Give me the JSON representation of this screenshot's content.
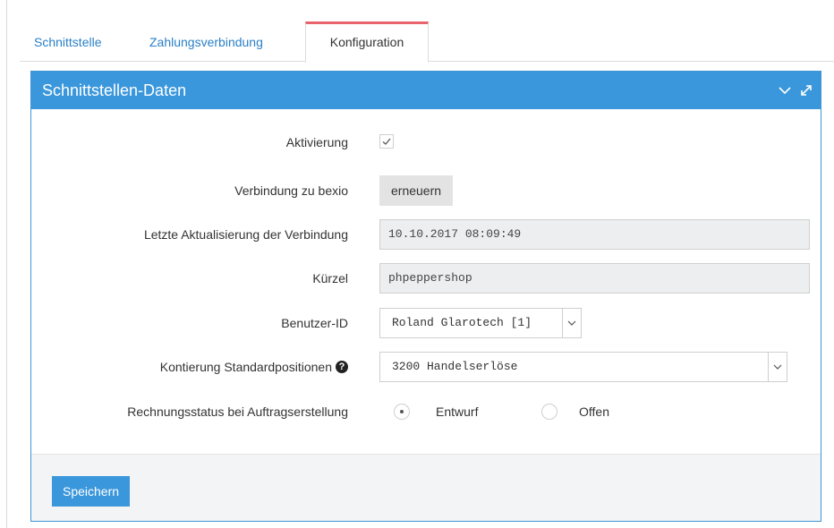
{
  "tabs": [
    {
      "label": "Schnittstelle"
    },
    {
      "label": "Zahlungsverbindung"
    },
    {
      "label": "Konfiguration"
    }
  ],
  "colors": {
    "accent": "#3a97dc",
    "active_tab_border": "#e8636c",
    "link": "#2a7fc7"
  },
  "panel": {
    "title": "Schnittstellen-Daten",
    "icons": [
      "chevron-down-icon",
      "expand-icon"
    ]
  },
  "form": {
    "aktivierung": {
      "label": "Aktivierung",
      "checked": true
    },
    "verbindung": {
      "label": "Verbindung zu bexio",
      "button": "erneuern"
    },
    "letzte": {
      "label": "Letzte Aktualisierung der Verbindung",
      "value": "10.10.2017 08:09:49"
    },
    "kuerzel": {
      "label": "Kürzel",
      "value": "phpeppershop"
    },
    "benutzer": {
      "label": "Benutzer-ID",
      "selected": "Roland Glarotech [1]"
    },
    "kontierung": {
      "label": "Kontierung Standardpositionen",
      "selected": "3200 Handelserlöse",
      "help": "?"
    },
    "rechnungsstatus": {
      "label": "Rechnungsstatus bei Auftragserstellung",
      "options": [
        "Entwurf",
        "Offen"
      ],
      "selected": "Entwurf"
    }
  },
  "footer": {
    "save_label": "Speichern"
  }
}
